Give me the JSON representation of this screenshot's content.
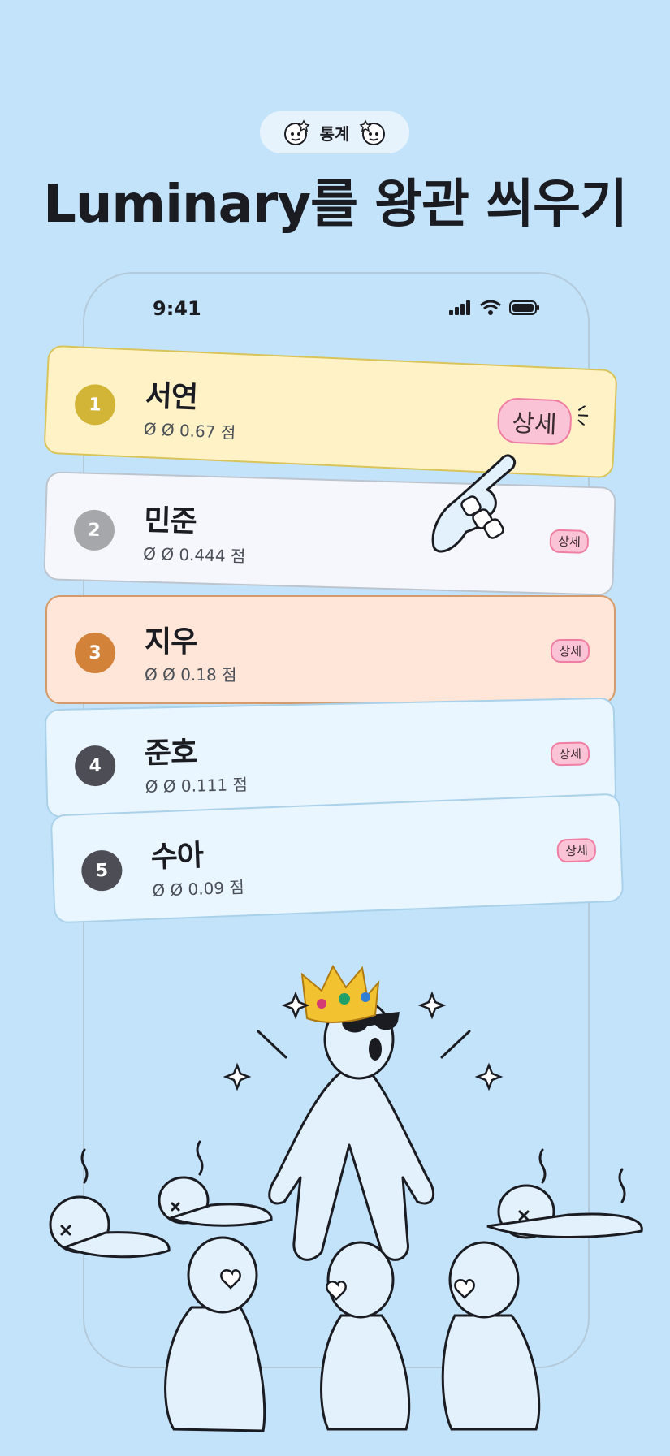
{
  "header": {
    "pill_label": "통계",
    "title": "Luminary를 왕관 씌우기"
  },
  "status_bar": {
    "time": "9:41",
    "icons": [
      "signal-icon",
      "wifi-icon",
      "battery-icon"
    ]
  },
  "leaderboard": [
    {
      "rank": "1",
      "name": "서연",
      "score": "Ø Ø 0.67 점",
      "detail": "상세",
      "rank_color": "#d2b436"
    },
    {
      "rank": "2",
      "name": "민준",
      "score": "Ø Ø 0.444 점",
      "detail": "상세",
      "rank_color": "#a5a7ab"
    },
    {
      "rank": "3",
      "name": "지우",
      "score": "Ø Ø 0.18 점",
      "detail": "상세",
      "rank_color": "#d3823a"
    },
    {
      "rank": "4",
      "name": "준호",
      "score": "Ø Ø 0.111 점",
      "detail": "상세",
      "rank_color": "#4c4d55"
    },
    {
      "rank": "5",
      "name": "수아",
      "score": "Ø Ø 0.09 점",
      "detail": "상세",
      "rank_color": "#4c4d55"
    }
  ],
  "colors": {
    "background": "#c3e3fb",
    "gold_card": "#fff2c6",
    "peach_card": "#ffe6d8",
    "detail_badge": "#fbc4d6"
  },
  "illustration": {
    "elements": [
      "crown-icon",
      "sunglasses-icon",
      "sparkle-icon",
      "pointing-hand-icon"
    ]
  }
}
